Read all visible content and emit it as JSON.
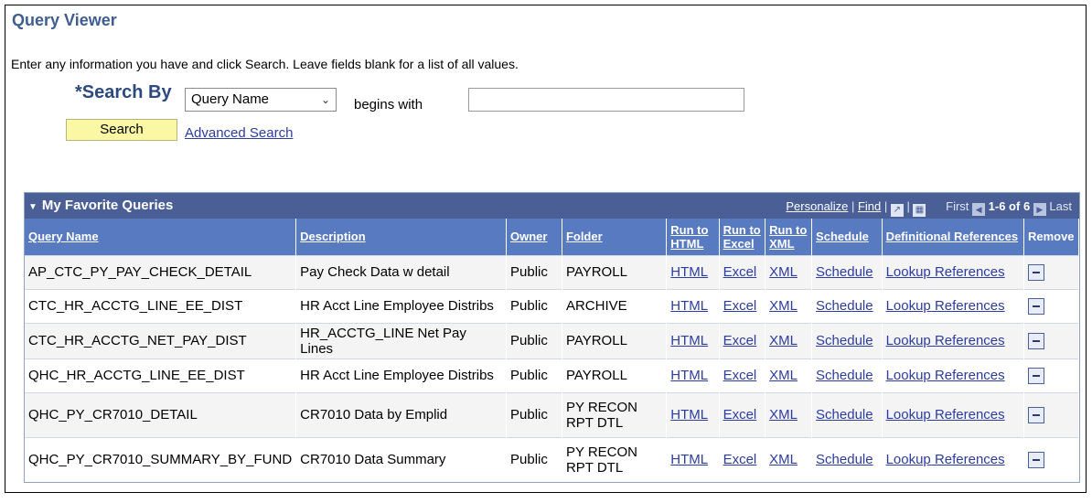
{
  "page": {
    "title": "Query Viewer",
    "instructions": "Enter any information you have and click Search. Leave fields blank for a list of all values."
  },
  "search": {
    "label": "*Search By",
    "by_value": "Query Name",
    "operator": "begins with",
    "value": "",
    "button_label": "Search",
    "advanced_link": "Advanced Search"
  },
  "grid": {
    "title": "My Favorite Queries",
    "nav": {
      "personalize": "Personalize",
      "find": "Find",
      "first": "First",
      "range": "1-6 of 6",
      "last": "Last"
    },
    "columns": {
      "query_name": "Query Name",
      "description": "Description",
      "owner": "Owner",
      "folder": "Folder",
      "run_html": "Run to HTML",
      "run_excel": "Run to Excel",
      "run_xml": "Run to XML",
      "schedule": "Schedule",
      "def_refs": "Definitional References",
      "remove": "Remove"
    },
    "rows": [
      {
        "name": "AP_CTC_PY_PAY_CHECK_DETAIL",
        "description": "Pay Check Data w detail",
        "owner": "Public",
        "folder": "PAYROLL",
        "html": "HTML",
        "excel": "Excel",
        "xml": "XML",
        "schedule": "Schedule",
        "refs": "Lookup References"
      },
      {
        "name": "CTC_HR_ACCTG_LINE_EE_DIST",
        "description": "HR Acct Line Employee Distribs",
        "owner": "Public",
        "folder": "ARCHIVE",
        "html": "HTML",
        "excel": "Excel",
        "xml": "XML",
        "schedule": "Schedule",
        "refs": "Lookup References"
      },
      {
        "name": "CTC_HR_ACCTG_NET_PAY_DIST",
        "description": "HR_ACCTG_LINE Net Pay Lines",
        "owner": "Public",
        "folder": "PAYROLL",
        "html": "HTML",
        "excel": "Excel",
        "xml": "XML",
        "schedule": "Schedule",
        "refs": "Lookup References"
      },
      {
        "name": "QHC_HR_ACCTG_LINE_EE_DIST",
        "description": "HR Acct Line Employee Distribs",
        "owner": "Public",
        "folder": "PAYROLL",
        "html": "HTML",
        "excel": "Excel",
        "xml": "XML",
        "schedule": "Schedule",
        "refs": "Lookup References"
      },
      {
        "name": "QHC_PY_CR7010_DETAIL",
        "description": "CR7010 Data by Emplid",
        "owner": "Public",
        "folder": "PY RECON RPT DTL",
        "html": "HTML",
        "excel": "Excel",
        "xml": "XML",
        "schedule": "Schedule",
        "refs": "Lookup References"
      },
      {
        "name": "QHC_PY_CR7010_SUMMARY_BY_FUND",
        "description": "CR7010 Data Summary",
        "owner": "Public",
        "folder": "PY RECON RPT DTL",
        "html": "HTML",
        "excel": "Excel",
        "xml": "XML",
        "schedule": "Schedule",
        "refs": "Lookup References"
      }
    ]
  }
}
